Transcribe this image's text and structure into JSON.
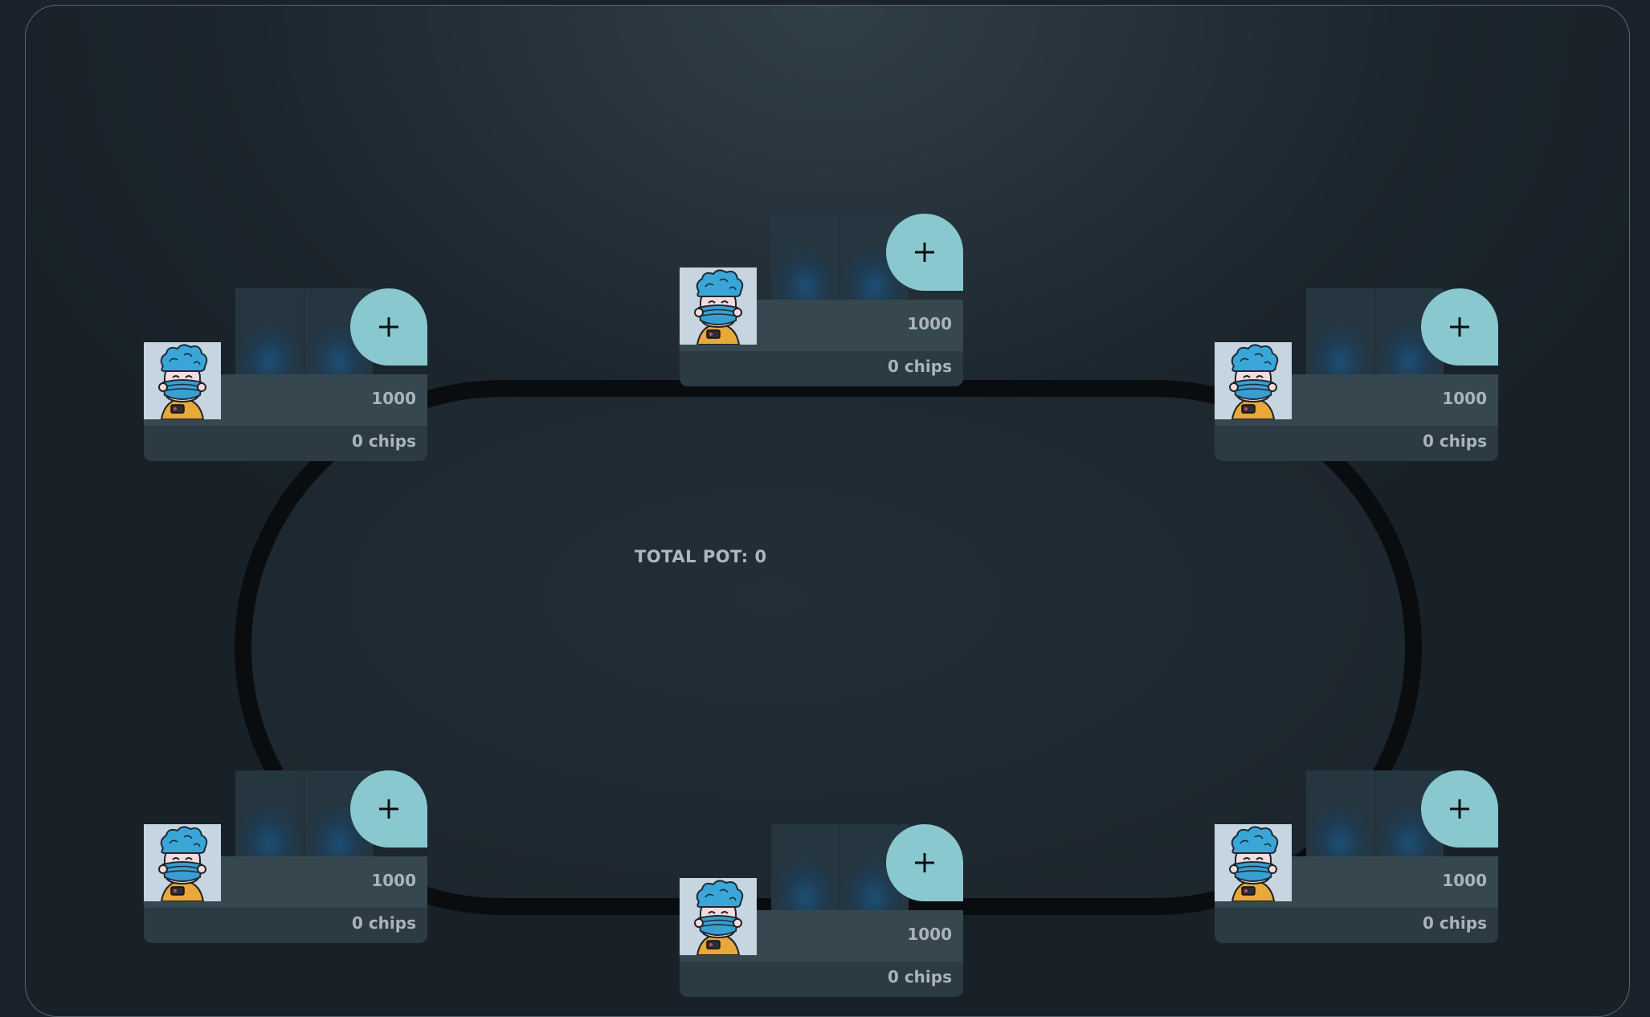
{
  "table": {
    "total_pot_label": "TOTAL POT: 0"
  },
  "seats": [
    {
      "id": "top-left",
      "stack": "1000",
      "chips": "0 chips",
      "add_icon": "plus-icon",
      "avatar": "masked-chef-avatar"
    },
    {
      "id": "top-center",
      "stack": "1000",
      "chips": "0 chips",
      "add_icon": "plus-icon",
      "avatar": "masked-chef-avatar"
    },
    {
      "id": "top-right",
      "stack": "1000",
      "chips": "0 chips",
      "add_icon": "plus-icon",
      "avatar": "masked-chef-avatar"
    },
    {
      "id": "bottom-left",
      "stack": "1000",
      "chips": "0 chips",
      "add_icon": "plus-icon",
      "avatar": "masked-chef-avatar"
    },
    {
      "id": "bottom-center",
      "stack": "1000",
      "chips": "0 chips",
      "add_icon": "plus-icon",
      "avatar": "masked-chef-avatar"
    },
    {
      "id": "bottom-right",
      "stack": "1000",
      "chips": "0 chips",
      "add_icon": "plus-icon",
      "avatar": "masked-chef-avatar"
    }
  ],
  "colors": {
    "add_button": "#8ac8cf",
    "table_rail": "#0a0d10",
    "seat_bar": "#37474f",
    "card_back": "#1c4f74"
  }
}
